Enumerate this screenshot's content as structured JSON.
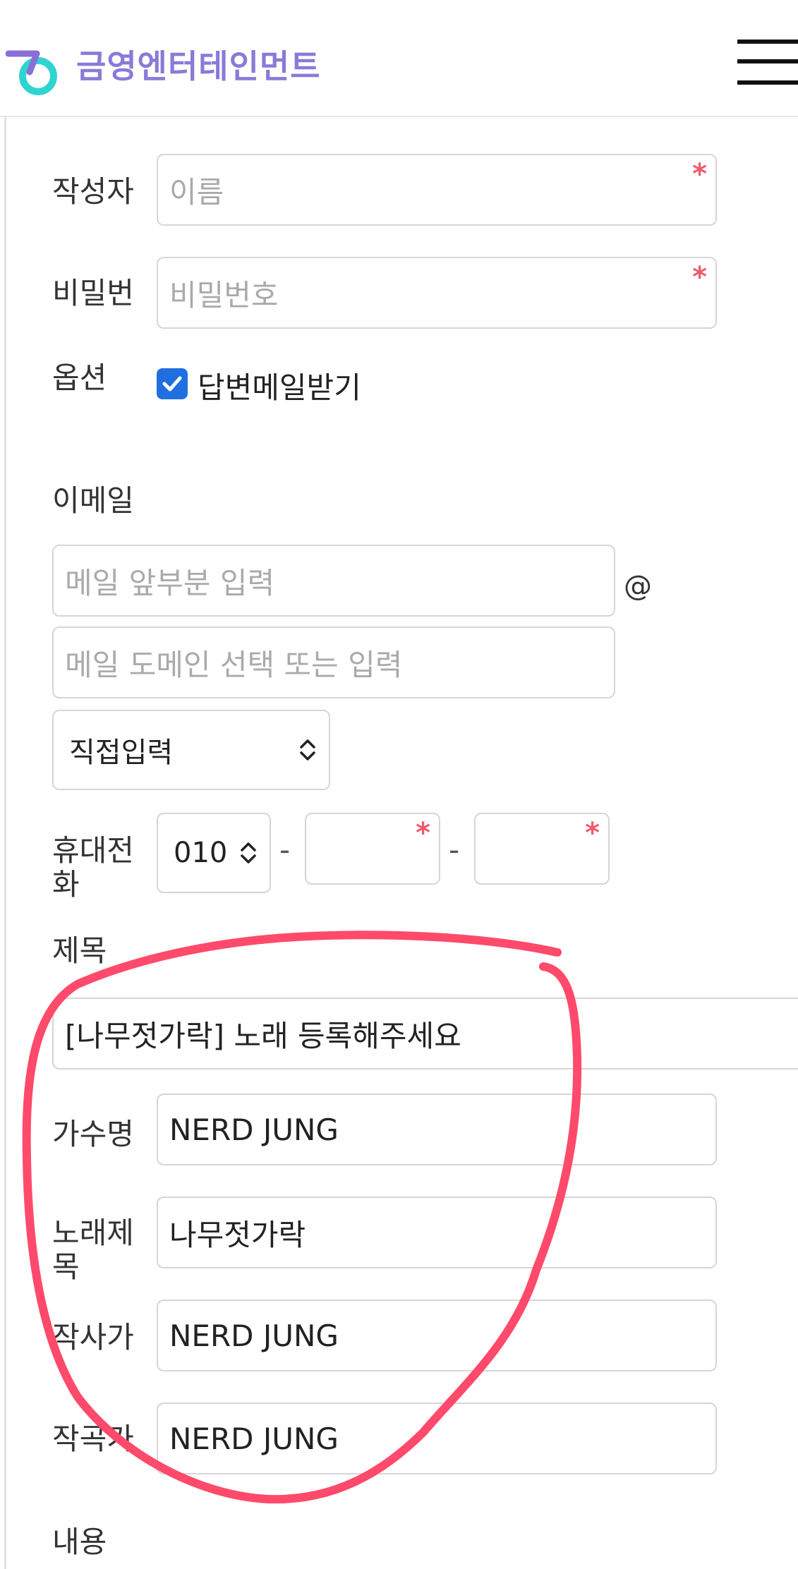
{
  "header": {
    "brand": "금영엔터테인먼트"
  },
  "form": {
    "author": {
      "label": "작성자",
      "placeholder": "이름",
      "required_mark": "*"
    },
    "password": {
      "label": "비밀번호",
      "placeholder": "비밀번호",
      "required_mark": "*"
    },
    "option": {
      "label": "옵션",
      "checkbox_label": "답변메일받기",
      "checked": true
    },
    "email": {
      "label": "이메일",
      "local_placeholder": "메일 앞부분 입력",
      "at": "@",
      "domain_placeholder": "메일 도메인 선택 또는 입력",
      "domain_select": "직접입력"
    },
    "phone": {
      "label": "휴대전화",
      "prefix": "010",
      "separator": "-",
      "required_mark": "*"
    },
    "subject": {
      "label": "제목",
      "value": "[나무젓가락] 노래 등록해주세요"
    },
    "singer": {
      "label": "가수명",
      "value": "NERD JUNG"
    },
    "song_title": {
      "label": "노래제목",
      "value": "나무젓가락"
    },
    "lyricist": {
      "label": "작사가",
      "value": "NERD JUNG"
    },
    "composer": {
      "label": "작곡가",
      "value": "NERD JUNG"
    },
    "content": {
      "label": "내용"
    }
  },
  "colors": {
    "brand": "#8a7ad8",
    "checkbox": "#1f6fe0",
    "required": "#f05a6a",
    "annotation": "#ff4a6b"
  },
  "icons": [
    "brand-logo-icon",
    "hamburger-menu-icon",
    "check-icon",
    "select-chevron-icon"
  ]
}
